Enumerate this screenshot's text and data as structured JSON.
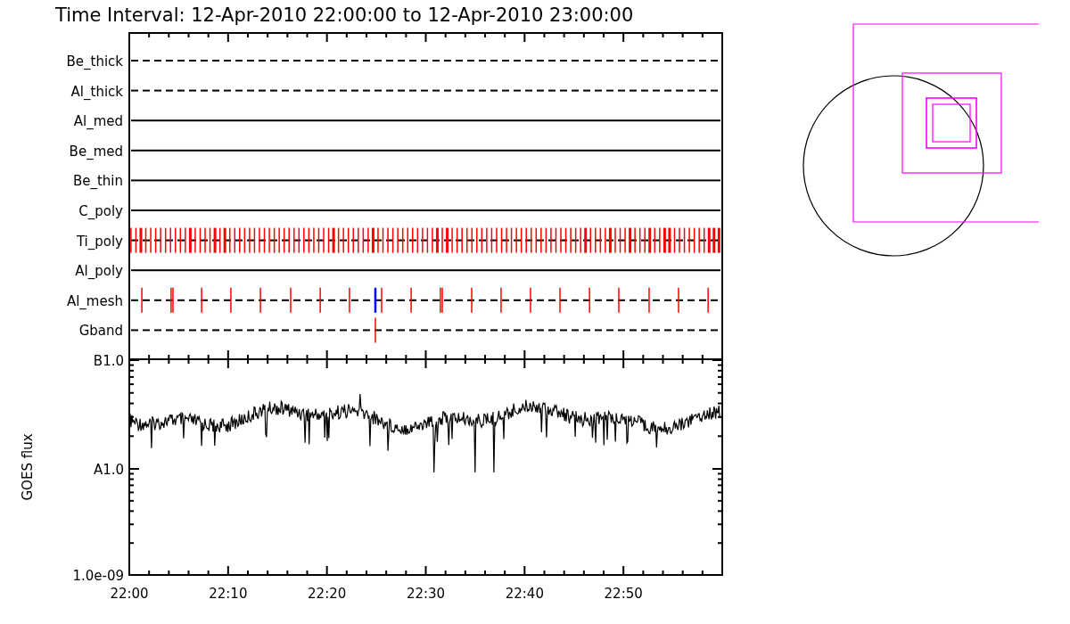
{
  "title": "Time Interval: 12-Apr-2010 22:00:00 to 12-Apr-2010 23:00:00",
  "channels": [
    {
      "label": "Be_thick",
      "dashed": true,
      "kind": "none"
    },
    {
      "label": "Al_thick",
      "dashed": true,
      "kind": "none"
    },
    {
      "label": "Al_med",
      "dashed": false,
      "kind": "none"
    },
    {
      "label": "Be_med",
      "dashed": false,
      "kind": "none"
    },
    {
      "label": "Be_thin",
      "dashed": false,
      "kind": "none"
    },
    {
      "label": "C_poly",
      "dashed": false,
      "kind": "none"
    },
    {
      "label": "Ti_poly",
      "dashed": true,
      "kind": "dense"
    },
    {
      "label": "Al_poly",
      "dashed": false,
      "kind": "none"
    },
    {
      "label": "Al_mesh",
      "dashed": true,
      "kind": "periodic"
    },
    {
      "label": "Gband",
      "dashed": true,
      "kind": "single"
    }
  ],
  "flux_panel": {
    "ylabel": "GOES flux",
    "yticks": [
      "B1.0",
      "A1.0",
      "1.0e-09"
    ],
    "xticks": [
      "22:00",
      "22:10",
      "22:20",
      "22:30",
      "22:40",
      "22:50"
    ]
  }
}
